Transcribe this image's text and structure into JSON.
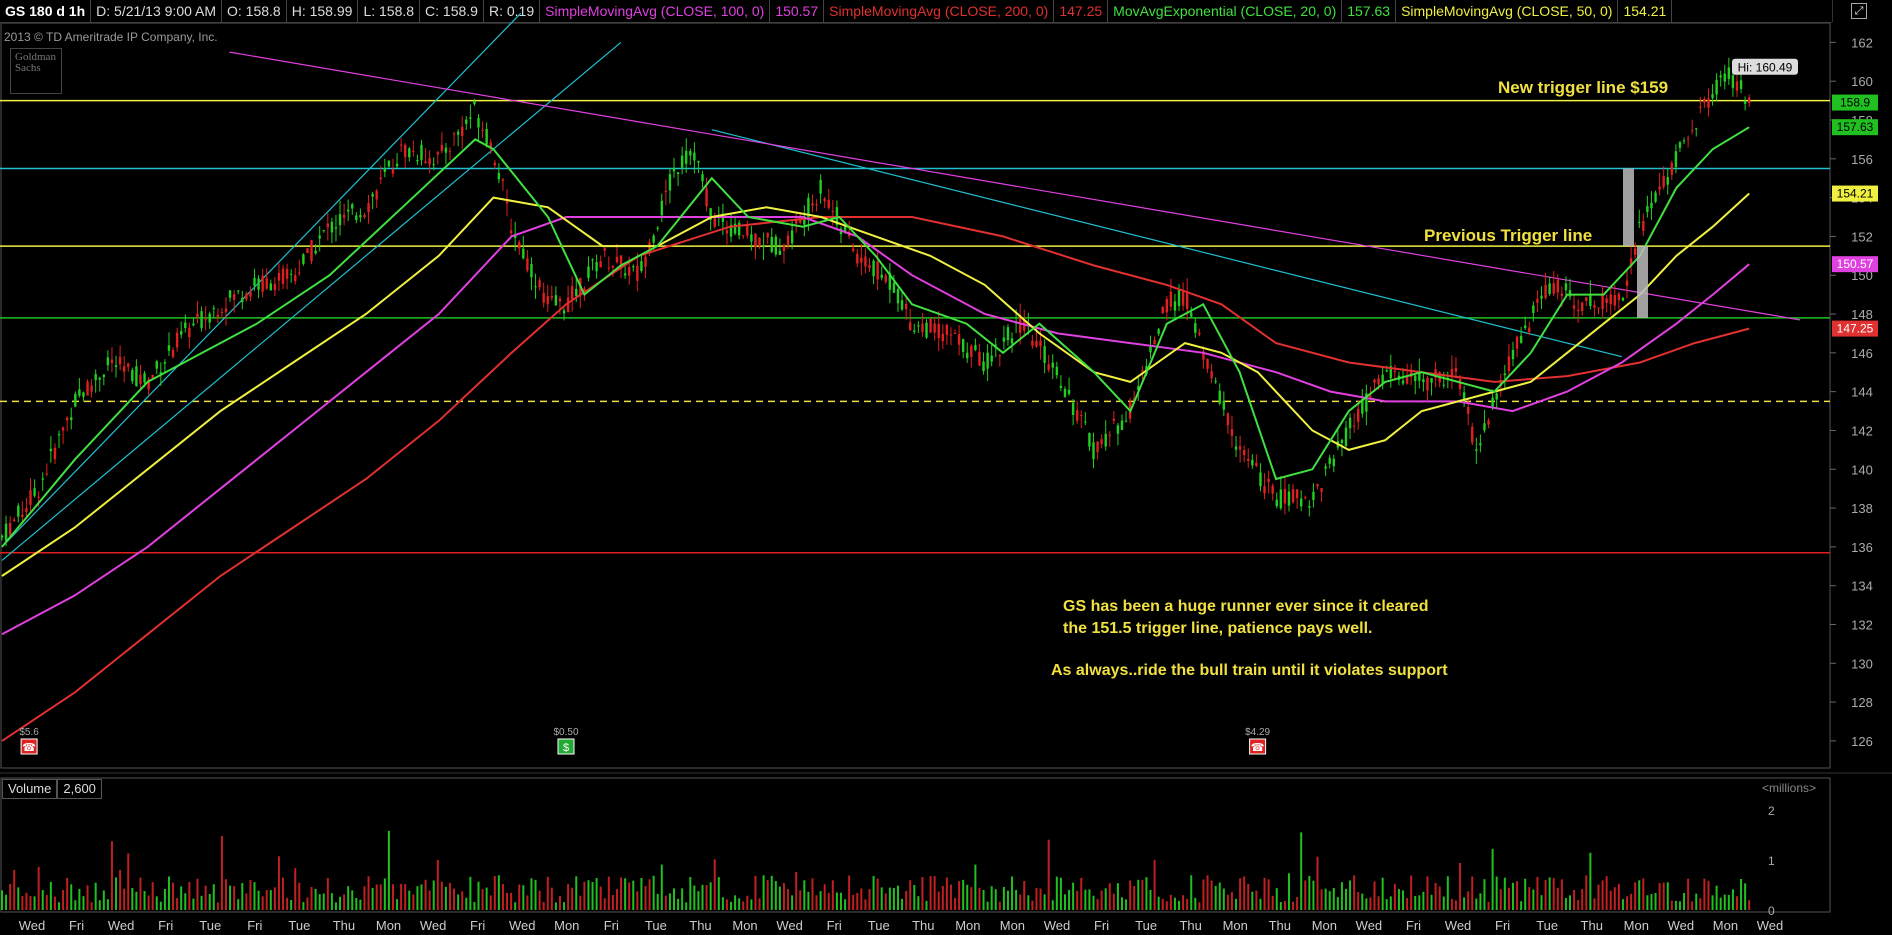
{
  "header": {
    "cells": [
      {
        "text": "GS 180 d 1h",
        "color": "#ffffff"
      },
      {
        "text": "D: 5/21/13 9:00 AM",
        "color": "#dddddd"
      },
      {
        "text": "O: 158.8",
        "color": "#dddddd"
      },
      {
        "text": "H: 158.99",
        "color": "#dddddd"
      },
      {
        "text": "L: 158.8",
        "color": "#dddddd"
      },
      {
        "text": "C: 158.9",
        "color": "#dddddd"
      },
      {
        "text": "R: 0.19",
        "color": "#dddddd"
      },
      {
        "text": "SimpleMovingAvg (CLOSE, 100, 0)",
        "color": "#e040e0"
      },
      {
        "text": "150.57",
        "color": "#e040e0"
      },
      {
        "text": "SimpleMovingAvg (CLOSE, 200, 0)",
        "color": "#e03030"
      },
      {
        "text": "147.25",
        "color": "#e03030"
      },
      {
        "text": "MovAvgExponential (CLOSE, 20, 0)",
        "color": "#40e040"
      },
      {
        "text": "157.63",
        "color": "#40e040"
      },
      {
        "text": "SimpleMovingAvg (CLOSE, 50, 0)",
        "color": "#f0f040"
      },
      {
        "text": "154.21",
        "color": "#f0f040"
      }
    ],
    "window_icon": "maximize-icon"
  },
  "copyright": "2013 © TD Ameritrade IP Company, Inc.",
  "logo_text": "Goldman Sachs",
  "annotations": {
    "new_trigger": "New trigger line $159",
    "previous_trigger": "Previous Trigger line",
    "note_line1": "GS has been a huge runner ever since it cleared",
    "note_line2": "the 151.5 trigger line, patience pays well.",
    "note_line3": "As always..ride the bull train until it violates support",
    "high_label": "Hi: 160.49"
  },
  "volume_header": {
    "label": "Volume",
    "value": "2,600",
    "units": "<millions>"
  },
  "colors": {
    "up_candle": "#20d020",
    "down_candle": "#e02020",
    "sma100": "#e040e0",
    "sma200": "#e03030",
    "ema20": "#40e040",
    "sma50": "#f0f040",
    "trigger_line": "#f0f040",
    "cyan_line": "#20c0d0",
    "green_level": "#20c020",
    "support_dashed": "#f0e040",
    "red_level": "#e02020"
  },
  "chart_data": {
    "type": "candlestick",
    "symbol": "GS",
    "timeframe": "180 d 1h",
    "y_axis": {
      "range": [
        124.5,
        163
      ],
      "ticks": [
        162,
        160,
        158,
        156,
        154,
        152,
        150,
        148,
        146,
        144,
        142,
        140,
        138,
        136,
        134,
        132,
        130,
        128,
        126
      ]
    },
    "x_labels": [
      "Wed",
      "Fri",
      "Wed",
      "Fri",
      "Tue",
      "Fri",
      "Tue",
      "Thu",
      "Mon",
      "Wed",
      "Fri",
      "Wed",
      "Mon",
      "Fri",
      "Tue",
      "Thu",
      "Mon",
      "Wed",
      "Fri",
      "Tue",
      "Thu",
      "Mon",
      "Mon",
      "Wed",
      "Fri",
      "Tue",
      "Thu",
      "Mon",
      "Thu",
      "Mon",
      "Wed",
      "Fri",
      "Wed",
      "Fri",
      "Tue",
      "Thu",
      "Mon",
      "Wed",
      "Mon",
      "Wed"
    ],
    "price_path": [
      [
        0,
        136.5
      ],
      [
        0.02,
        139
      ],
      [
        0.04,
        143.5
      ],
      [
        0.06,
        145.5
      ],
      [
        0.08,
        144.5
      ],
      [
        0.1,
        147
      ],
      [
        0.12,
        148.5
      ],
      [
        0.14,
        149.5
      ],
      [
        0.16,
        150
      ],
      [
        0.18,
        152.5
      ],
      [
        0.2,
        153.5
      ],
      [
        0.22,
        156.5
      ],
      [
        0.24,
        156
      ],
      [
        0.26,
        158.5
      ],
      [
        0.27,
        156.5
      ],
      [
        0.28,
        152.5
      ],
      [
        0.3,
        148.5
      ],
      [
        0.31,
        148.5
      ],
      [
        0.33,
        151
      ],
      [
        0.35,
        150
      ],
      [
        0.37,
        155.5
      ],
      [
        0.38,
        156.5
      ],
      [
        0.39,
        153
      ],
      [
        0.41,
        152
      ],
      [
        0.43,
        151.5
      ],
      [
        0.45,
        154.5
      ],
      [
        0.47,
        151
      ],
      [
        0.49,
        149.5
      ],
      [
        0.5,
        147.5
      ],
      [
        0.52,
        147
      ],
      [
        0.54,
        145.5
      ],
      [
        0.56,
        147.5
      ],
      [
        0.58,
        145
      ],
      [
        0.6,
        141
      ],
      [
        0.62,
        143
      ],
      [
        0.64,
        148.5
      ],
      [
        0.65,
        149
      ],
      [
        0.66,
        146
      ],
      [
        0.68,
        141
      ],
      [
        0.7,
        138.5
      ],
      [
        0.72,
        138.5
      ],
      [
        0.74,
        142
      ],
      [
        0.76,
        145
      ],
      [
        0.78,
        144.5
      ],
      [
        0.8,
        145
      ],
      [
        0.81,
        141
      ],
      [
        0.83,
        146
      ],
      [
        0.85,
        149.5
      ],
      [
        0.87,
        148.5
      ],
      [
        0.89,
        149
      ],
      [
        0.9,
        152.5
      ],
      [
        0.92,
        156
      ],
      [
        0.94,
        159.5
      ],
      [
        0.95,
        160.3
      ],
      [
        0.96,
        158.9
      ]
    ],
    "ema20": [
      [
        0,
        136
      ],
      [
        0.04,
        140.5
      ],
      [
        0.08,
        144.5
      ],
      [
        0.1,
        145.5
      ],
      [
        0.14,
        147.5
      ],
      [
        0.18,
        150
      ],
      [
        0.22,
        153.5
      ],
      [
        0.26,
        157
      ],
      [
        0.27,
        156.5
      ],
      [
        0.3,
        153
      ],
      [
        0.32,
        149
      ],
      [
        0.34,
        150.5
      ],
      [
        0.36,
        151.5
      ],
      [
        0.39,
        155
      ],
      [
        0.41,
        153
      ],
      [
        0.44,
        152.5
      ],
      [
        0.46,
        153
      ],
      [
        0.48,
        151
      ],
      [
        0.5,
        148.5
      ],
      [
        0.53,
        147.5
      ],
      [
        0.55,
        146
      ],
      [
        0.57,
        147.5
      ],
      [
        0.6,
        145
      ],
      [
        0.62,
        143
      ],
      [
        0.64,
        147.5
      ],
      [
        0.66,
        148.5
      ],
      [
        0.68,
        145
      ],
      [
        0.7,
        139.5
      ],
      [
        0.72,
        140
      ],
      [
        0.74,
        143
      ],
      [
        0.76,
        144.5
      ],
      [
        0.78,
        145
      ],
      [
        0.8,
        144.5
      ],
      [
        0.82,
        144
      ],
      [
        0.84,
        146
      ],
      [
        0.86,
        149
      ],
      [
        0.88,
        149
      ],
      [
        0.9,
        151
      ],
      [
        0.92,
        154.5
      ],
      [
        0.94,
        156.5
      ],
      [
        0.96,
        157.63
      ]
    ],
    "sma50": [
      [
        0,
        134.5
      ],
      [
        0.04,
        137
      ],
      [
        0.08,
        140
      ],
      [
        0.12,
        143
      ],
      [
        0.16,
        145.5
      ],
      [
        0.2,
        148
      ],
      [
        0.24,
        151
      ],
      [
        0.27,
        154
      ],
      [
        0.3,
        153.5
      ],
      [
        0.33,
        151.5
      ],
      [
        0.36,
        151.5
      ],
      [
        0.39,
        153
      ],
      [
        0.42,
        153.5
      ],
      [
        0.45,
        153
      ],
      [
        0.48,
        152
      ],
      [
        0.51,
        151
      ],
      [
        0.54,
        149.5
      ],
      [
        0.57,
        147
      ],
      [
        0.6,
        145
      ],
      [
        0.62,
        144.5
      ],
      [
        0.65,
        146.5
      ],
      [
        0.67,
        146
      ],
      [
        0.69,
        145
      ],
      [
        0.72,
        142
      ],
      [
        0.74,
        141
      ],
      [
        0.76,
        141.5
      ],
      [
        0.78,
        143
      ],
      [
        0.8,
        143.5
      ],
      [
        0.82,
        144
      ],
      [
        0.84,
        144.5
      ],
      [
        0.86,
        146
      ],
      [
        0.88,
        147.5
      ],
      [
        0.9,
        149
      ],
      [
        0.92,
        151
      ],
      [
        0.94,
        152.5
      ],
      [
        0.96,
        154.21
      ]
    ],
    "sma100": [
      [
        0,
        131.5
      ],
      [
        0.04,
        133.5
      ],
      [
        0.08,
        136
      ],
      [
        0.12,
        139
      ],
      [
        0.16,
        142
      ],
      [
        0.2,
        145
      ],
      [
        0.24,
        148
      ],
      [
        0.28,
        152
      ],
      [
        0.31,
        153
      ],
      [
        0.35,
        153
      ],
      [
        0.4,
        153
      ],
      [
        0.44,
        153
      ],
      [
        0.47,
        152
      ],
      [
        0.5,
        150
      ],
      [
        0.54,
        148
      ],
      [
        0.58,
        147
      ],
      [
        0.62,
        146.5
      ],
      [
        0.66,
        146
      ],
      [
        0.7,
        145
      ],
      [
        0.73,
        144
      ],
      [
        0.76,
        143.5
      ],
      [
        0.8,
        143.5
      ],
      [
        0.83,
        143
      ],
      [
        0.86,
        144
      ],
      [
        0.89,
        145.5
      ],
      [
        0.92,
        147.5
      ],
      [
        0.94,
        149
      ],
      [
        0.96,
        150.57
      ]
    ],
    "sma200": [
      [
        0,
        126
      ],
      [
        0.04,
        128.5
      ],
      [
        0.08,
        131.5
      ],
      [
        0.12,
        134.5
      ],
      [
        0.16,
        137
      ],
      [
        0.2,
        139.5
      ],
      [
        0.24,
        142.5
      ],
      [
        0.28,
        146
      ],
      [
        0.31,
        148.5
      ],
      [
        0.35,
        151
      ],
      [
        0.4,
        152.5
      ],
      [
        0.45,
        153
      ],
      [
        0.5,
        153
      ],
      [
        0.55,
        152
      ],
      [
        0.6,
        150.5
      ],
      [
        0.64,
        149.5
      ],
      [
        0.67,
        148.5
      ],
      [
        0.7,
        146.5
      ],
      [
        0.74,
        145.5
      ],
      [
        0.78,
        145
      ],
      [
        0.82,
        144.5
      ],
      [
        0.86,
        144.8
      ],
      [
        0.9,
        145.5
      ],
      [
        0.93,
        146.5
      ],
      [
        0.96,
        147.25
      ]
    ],
    "horizontal_lines": [
      {
        "price": 159,
        "color": "#f0f040",
        "style": "solid"
      },
      {
        "price": 155.5,
        "color": "#20c0d0",
        "style": "solid"
      },
      {
        "price": 151.5,
        "color": "#f0f040",
        "style": "solid"
      },
      {
        "price": 147.8,
        "color": "#20c020",
        "style": "solid"
      },
      {
        "price": 143.5,
        "color": "#f0e040",
        "style": "dashed"
      },
      {
        "price": 135.7,
        "color": "#e02020",
        "style": "solid"
      }
    ],
    "price_tags": [
      {
        "label": "158.9",
        "price": 158.9,
        "bg": "#20c020",
        "fg": "#000000"
      },
      {
        "label": "157.63",
        "price": 157.63,
        "bg": "#20c020",
        "fg": "#000000"
      },
      {
        "label": "154.21",
        "price": 154.21,
        "bg": "#f0f040",
        "fg": "#000000"
      },
      {
        "label": "150.57",
        "price": 150.57,
        "bg": "#e040e0",
        "fg": "#ffffff"
      },
      {
        "label": "147.25",
        "price": 147.25,
        "bg": "#e03030",
        "fg": "#ffffff"
      }
    ],
    "events": [
      {
        "label": "$5.6",
        "type": "earnings-red",
        "at": 0.005
      },
      {
        "label": "$0.50",
        "type": "dividend-green",
        "at": 0.3
      },
      {
        "label": "$4.29",
        "type": "earnings-red",
        "at": 0.68
      }
    ],
    "volume": {
      "unit": "millions",
      "ticks": [
        2,
        1,
        0
      ]
    }
  }
}
